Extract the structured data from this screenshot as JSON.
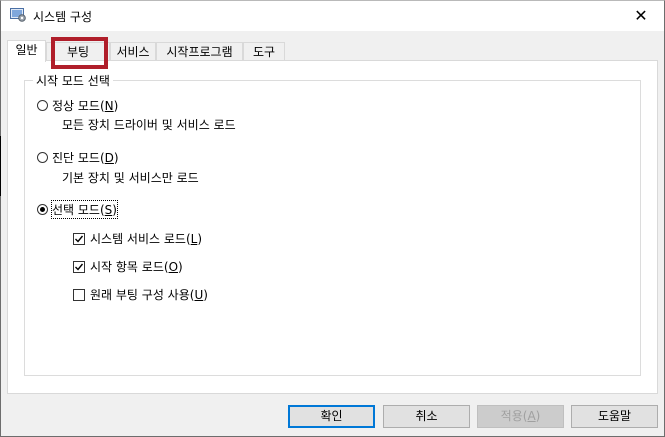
{
  "window": {
    "title": "시스템 구성",
    "close_glyph": "✕"
  },
  "tabs": [
    {
      "label": "일반",
      "active": true
    },
    {
      "label": "부팅",
      "active": false
    },
    {
      "label": "서비스",
      "active": false
    },
    {
      "label": "시작프로그램",
      "active": false
    },
    {
      "label": "도구",
      "active": false
    }
  ],
  "startup_selection": {
    "group_label": "시작 모드 선택",
    "normal": {
      "label": "정상 모드",
      "accel": "N",
      "description": "모든 장치 드라이버 및 서비스 로드",
      "selected": false
    },
    "diagnostic": {
      "label": "진단 모드",
      "accel": "D",
      "description": "기본 장치 및 서비스만 로드",
      "selected": false
    },
    "selective": {
      "label": "선택 모드",
      "accel": "S",
      "selected": true,
      "options": [
        {
          "label": "시스템 서비스 로드",
          "accel": "L",
          "checked": true
        },
        {
          "label": "시작 항목 로드",
          "accel": "O",
          "checked": true
        },
        {
          "label": "원래 부팅 구성 사용",
          "accel": "U",
          "checked": false
        }
      ]
    }
  },
  "buttons": {
    "ok": "확인",
    "cancel": "취소",
    "apply": "적용",
    "apply_accel": "A",
    "help": "도움말"
  },
  "colors": {
    "highlight_box": "#b01e2a",
    "default_button_border": "#0078d7"
  }
}
